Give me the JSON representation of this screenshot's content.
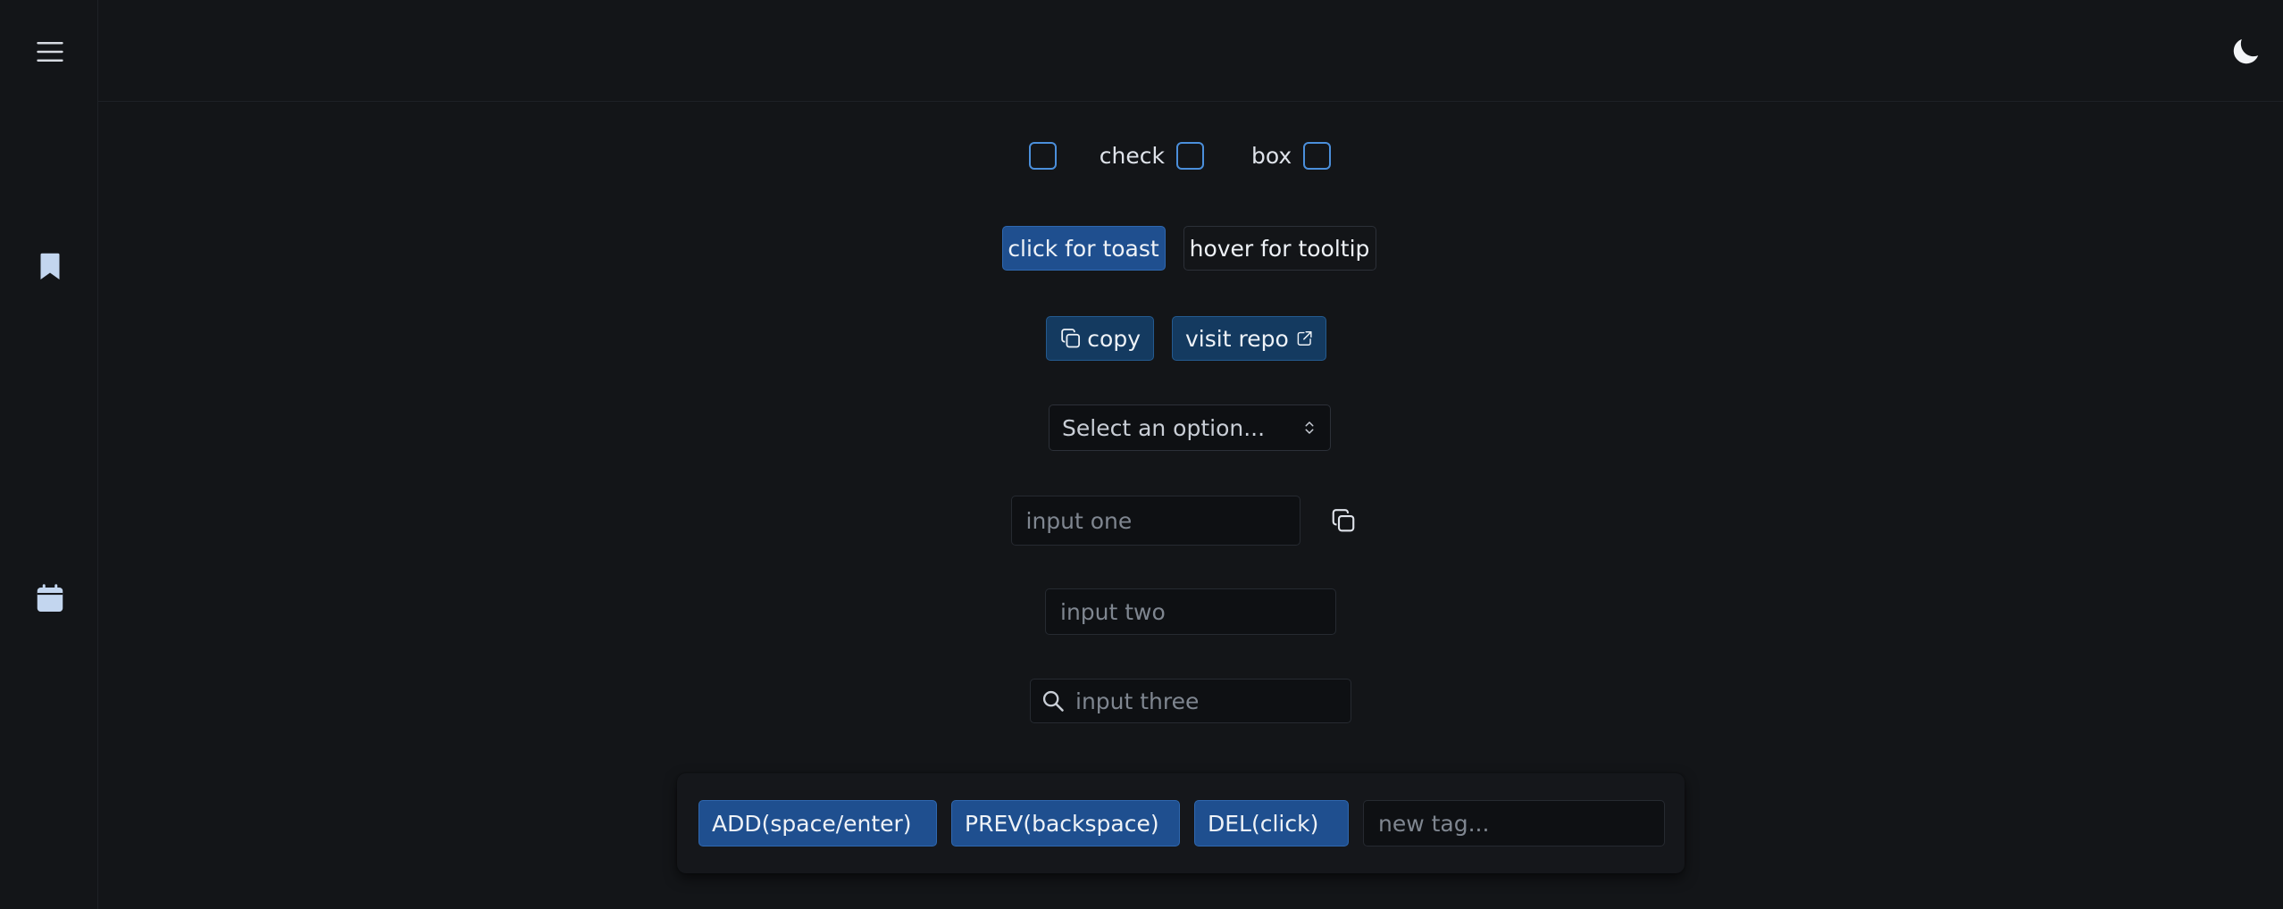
{
  "sidebar": {
    "icons": [
      "menu-icon",
      "bookmark-icon",
      "calendar-icon"
    ]
  },
  "header": {
    "theme_icon": "moon-icon"
  },
  "checkboxes": {
    "labels": [
      "check",
      "box"
    ]
  },
  "buttons": {
    "toast": "click for toast",
    "tooltip": "hover for tooltip",
    "copy": "copy",
    "visit_repo": "visit repo"
  },
  "select": {
    "placeholder": "Select an option..."
  },
  "inputs": {
    "one_placeholder": "input one",
    "two_placeholder": "input two",
    "three_placeholder": "input three"
  },
  "tags": {
    "add": "ADD(space/enter)",
    "prev": "PREV(backspace)",
    "del": "DEL(click)",
    "new_placeholder": "new tag..."
  },
  "colors": {
    "background": "#131518",
    "accent": "#1f4f8f",
    "checkbox_border": "#4b8fdb"
  }
}
